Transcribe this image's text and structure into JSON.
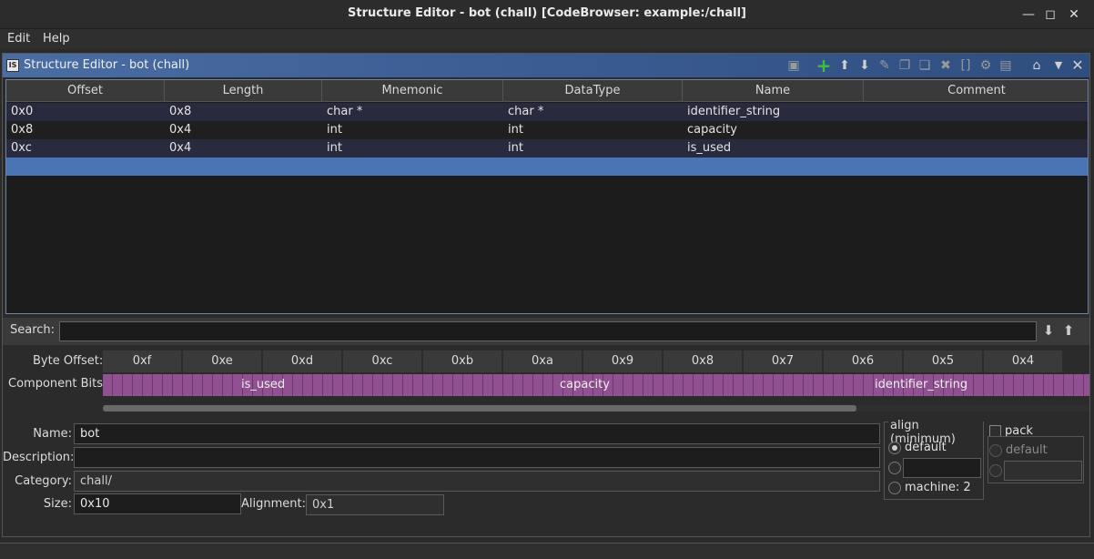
{
  "window": {
    "title": "Structure Editor - bot (chall) [CodeBrowser: example:/chall]",
    "minimize_icon": "minimize-icon",
    "maximize_icon": "maximize-icon",
    "close_icon": "close-icon"
  },
  "menu": {
    "items": [
      "Edit",
      "Help"
    ]
  },
  "panel": {
    "title": "Structure Editor - bot (chall)",
    "toolbar_icons": [
      "save-icon",
      "add-icon",
      "move-up-icon",
      "move-down-icon",
      "clear-icon",
      "duplicate-icon",
      "duplicate-multiple-icon",
      "delete-icon",
      "array-icon",
      "unpackage-icon",
      "show-component-path-icon",
      "home-icon",
      "menu-dropdown-icon",
      "close-icon"
    ]
  },
  "table": {
    "headers": [
      "Offset",
      "Length",
      "Mnemonic",
      "DataType",
      "Name",
      "Comment"
    ],
    "rows": [
      {
        "offset": "0x0",
        "length": "0x8",
        "mnemonic": "char *",
        "datatype": "char *",
        "name": "identifier_string",
        "comment": ""
      },
      {
        "offset": "0x8",
        "length": "0x4",
        "mnemonic": "int",
        "datatype": "int",
        "name": "capacity",
        "comment": ""
      },
      {
        "offset": "0xc",
        "length": "0x4",
        "mnemonic": "int",
        "datatype": "int",
        "name": "is_used",
        "comment": ""
      }
    ]
  },
  "search": {
    "label": "Search:",
    "value": ""
  },
  "bytes": {
    "offset_label": "Byte Offset:",
    "bits_label": "Component Bits:",
    "offsets": [
      "0xf",
      "0xe",
      "0xd",
      "0xc",
      "0xb",
      "0xa",
      "0x9",
      "0x8",
      "0x7",
      "0x6",
      "0x5",
      "0x4"
    ],
    "components": [
      "is_used",
      "capacity",
      "identifier_string"
    ]
  },
  "form": {
    "name_label": "Name:",
    "name_value": "bot",
    "description_label": "Description:",
    "description_value": "",
    "category_label": "Category:",
    "category_value": "chall/",
    "size_label": "Size:",
    "size_value": "0x10",
    "alignment_label": "Alignment:",
    "alignment_value": "0x1"
  },
  "align": {
    "legend": "align (minimum)",
    "default_label": "default",
    "machine_label": "machine: 2"
  },
  "pack": {
    "label": "pack",
    "default_label": "default"
  }
}
